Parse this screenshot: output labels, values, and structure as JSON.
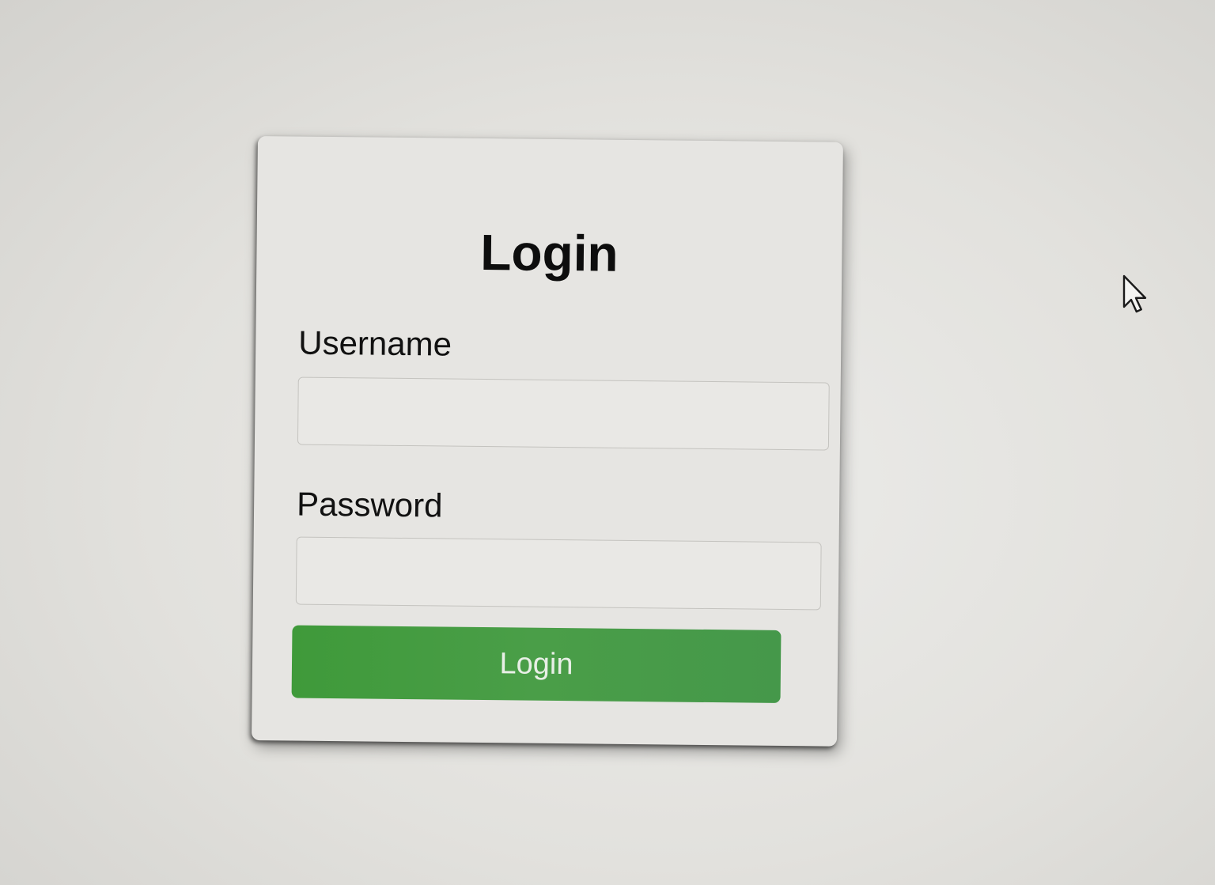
{
  "login_form": {
    "title": "Login",
    "username_label": "Username",
    "username_value": "",
    "password_label": "Password",
    "password_value": "",
    "submit_label": "Login"
  },
  "colors": {
    "background": "#e2e1dd",
    "card": "#e6e5e2",
    "button": "#45984a",
    "button_text": "#e8efe6",
    "text": "#111111"
  },
  "icons": {
    "cursor": "arrow-cursor-icon"
  }
}
